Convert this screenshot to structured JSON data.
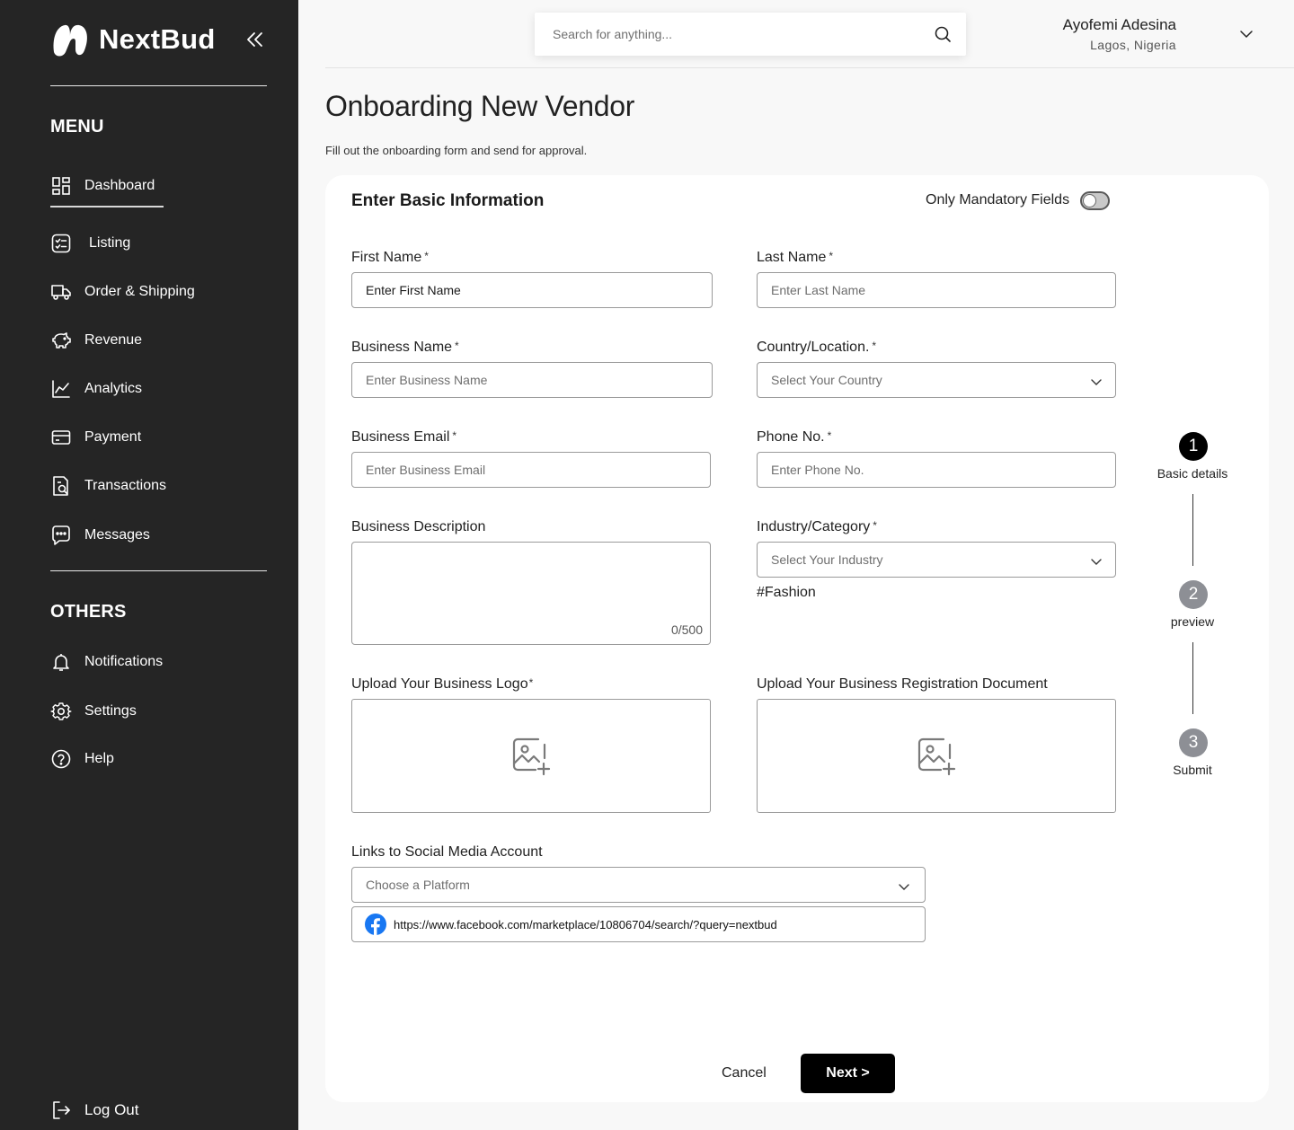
{
  "brand": {
    "name": "NextBud"
  },
  "sidebar": {
    "menu_title": "MENU",
    "menu_items": [
      {
        "label": "Dashboard",
        "icon": "dashboard-icon"
      },
      {
        "label": "Listing",
        "icon": "listing-icon"
      },
      {
        "label": "Order & Shipping",
        "icon": "truck-icon"
      },
      {
        "label": "Revenue",
        "icon": "piggy-bank-icon"
      },
      {
        "label": "Analytics",
        "icon": "analytics-icon"
      },
      {
        "label": "Payment",
        "icon": "card-icon"
      },
      {
        "label": "Transactions",
        "icon": "transactions-icon"
      },
      {
        "label": "Messages",
        "icon": "message-icon"
      }
    ],
    "others_title": "OTHERS",
    "other_items": [
      {
        "label": "Notifications",
        "icon": "bell-icon"
      },
      {
        "label": "Settings",
        "icon": "gear-icon"
      },
      {
        "label": "Help",
        "icon": "help-icon"
      }
    ],
    "logout_label": "Log Out",
    "active_item": "Dashboard"
  },
  "header": {
    "search_placeholder": "Search for anything...",
    "user_name": "Ayofemi Adesina",
    "user_location": "Lagos, Nigeria"
  },
  "page": {
    "title": "Onboarding New Vendor",
    "subtitle": "Fill out the onboarding form and send for approval."
  },
  "form": {
    "section_title": "Enter Basic Information",
    "mandatory_toggle_label": "Only Mandatory Fields",
    "mandatory_toggle_on": false,
    "required_mark": "*",
    "first_name": {
      "label": "First Name",
      "value": "Enter First Name"
    },
    "last_name": {
      "label": "Last Name",
      "placeholder": "Enter Last Name"
    },
    "business_name": {
      "label": "Business Name",
      "placeholder": "Enter Business Name"
    },
    "country": {
      "label": "Country/Location.",
      "placeholder": "Select Your Country"
    },
    "business_email": {
      "label": "Business Email",
      "placeholder": "Enter Business Email"
    },
    "phone": {
      "label": "Phone No.",
      "placeholder": "Enter Phone No."
    },
    "description": {
      "label": "Business Description",
      "counter": "0/500"
    },
    "industry": {
      "label": "Industry/Category",
      "placeholder": "Select Your Industry",
      "tag": "#Fashion"
    },
    "logo_upload": {
      "label": "Upload Your Business Logo"
    },
    "doc_upload": {
      "label": "Upload Your Business Registration Document"
    },
    "social": {
      "label": "Links to Social Media Account",
      "platform_placeholder": "Choose a Platform",
      "link": "https://www.facebook.com/marketplace/10806704/search/?query=nextbud",
      "link_icon": "facebook-icon"
    },
    "cancel_label": "Cancel",
    "next_label": "Next >"
  },
  "stepper": {
    "steps": [
      {
        "number": "1",
        "label": "Basic details",
        "active": true
      },
      {
        "number": "2",
        "label": "preview",
        "active": false
      },
      {
        "number": "3",
        "label": "Submit",
        "active": false
      }
    ]
  },
  "colors": {
    "sidebar_bg": "#252525",
    "page_bg": "#f8f8f8",
    "primary_button": "#000000",
    "inactive_step": "#8d8f95",
    "facebook": "#1877f2"
  }
}
